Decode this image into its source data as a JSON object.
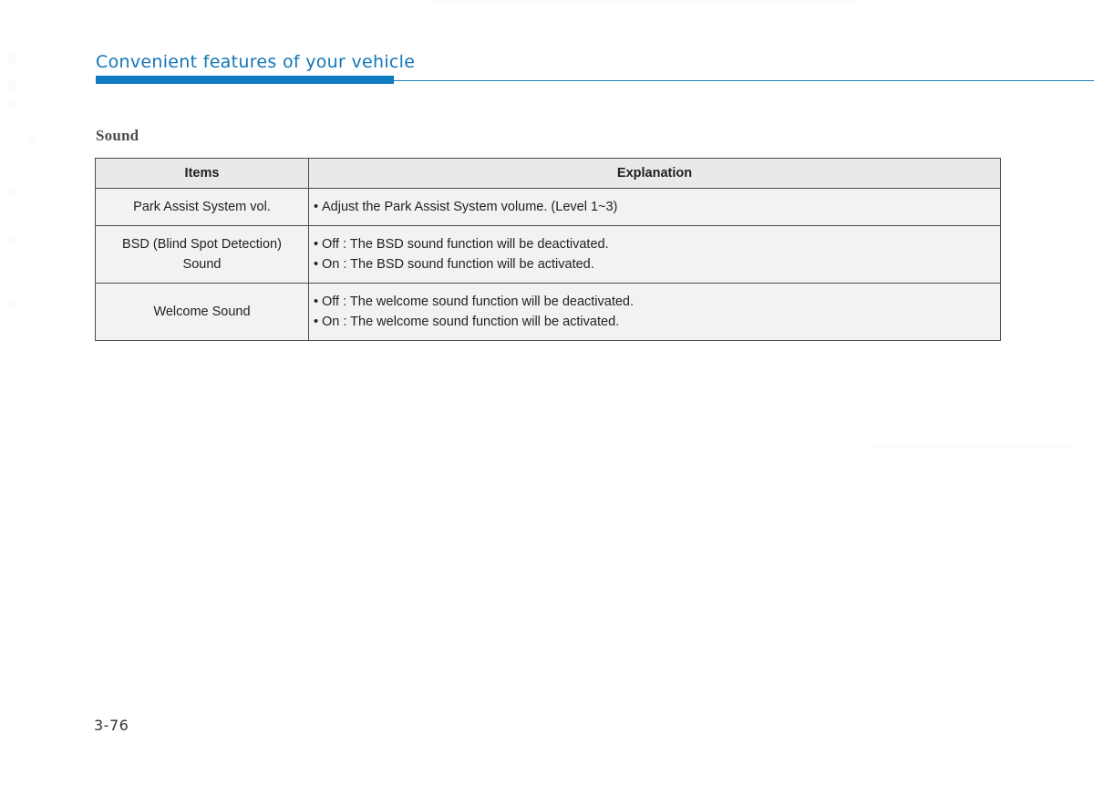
{
  "header": {
    "title": "Convenient features of your vehicle",
    "accent_color": "#0f7ac0",
    "rule_color": "#1a7cbd"
  },
  "section": {
    "title": "Sound"
  },
  "table": {
    "columns": [
      "Items",
      "Explanation"
    ],
    "rows": [
      {
        "item": "Park Assist System vol.",
        "lines": [
          "Adjust the Park Assist System volume. (Level 1~3)"
        ]
      },
      {
        "item": "BSD (Blind Spot Detection) Sound",
        "item_line1": "BSD (Blind Spot Detection)",
        "item_line2": "Sound",
        "lines": [
          "Off : The BSD sound function will be deactivated.",
          "On : The BSD sound function will be activated."
        ]
      },
      {
        "item": "Welcome Sound",
        "lines": [
          "Off : The welcome sound function will be deactivated.",
          "On : The welcome sound function will be activated."
        ]
      }
    ]
  },
  "footer": {
    "page_number": "3-76"
  }
}
